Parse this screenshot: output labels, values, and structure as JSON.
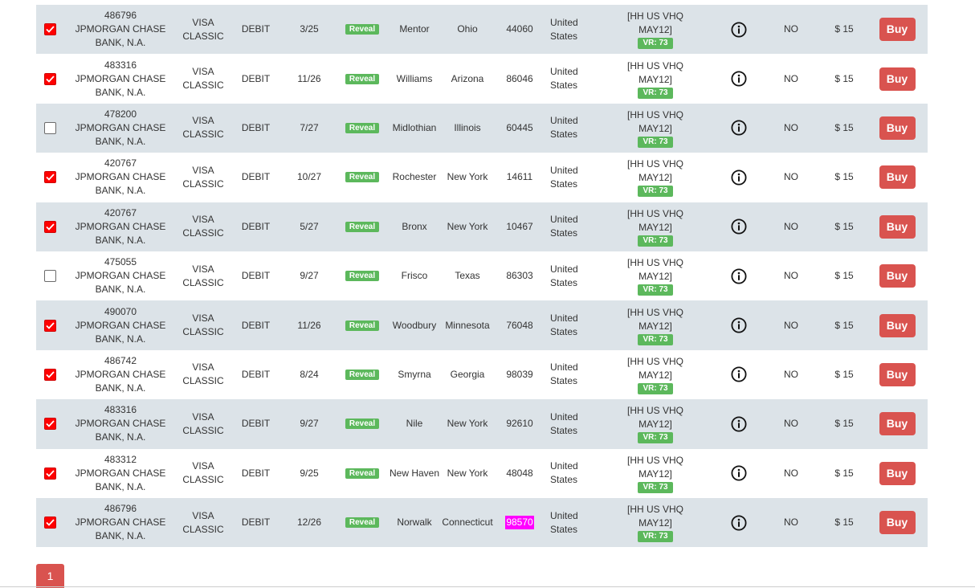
{
  "colors": {
    "row_shaded": "#dce3e8",
    "checkbox_checked": "#ff0000",
    "reveal_badge": "#5cb85c",
    "buy_button": "#d9534f",
    "zip_highlight": "#ff00ff"
  },
  "rows": [
    {
      "checked": true,
      "bin": "486796",
      "bank": "JPMORGAN CHASE",
      "bank2": "BANK, N.A.",
      "brand": "VISA",
      "level": "CLASSIC",
      "type": "DEBIT",
      "exp": "3/25",
      "reveal": "Reveal",
      "city": "Mentor",
      "state": "Ohio",
      "zip": "44060",
      "country": "United",
      "country2": "States",
      "base1": "[HH US VHQ",
      "base2": "MAY12]",
      "vr": "VR: 73",
      "info_icon": "info-circle-icon",
      "refund": "NO",
      "price": "$ 15",
      "buy": "Buy"
    },
    {
      "checked": true,
      "bin": "483316",
      "bank": "JPMORGAN CHASE",
      "bank2": "BANK, N.A.",
      "brand": "VISA",
      "level": "CLASSIC",
      "type": "DEBIT",
      "exp": "11/26",
      "reveal": "Reveal",
      "city": "Williams",
      "state": "Arizona",
      "zip": "86046",
      "country": "United",
      "country2": "States",
      "base1": "[HH US VHQ",
      "base2": "MAY12]",
      "vr": "VR: 73",
      "info_icon": "info-circle-icon",
      "refund": "NO",
      "price": "$ 15",
      "buy": "Buy"
    },
    {
      "checked": false,
      "bin": "478200",
      "bank": "JPMORGAN CHASE",
      "bank2": "BANK, N.A.",
      "brand": "VISA",
      "level": "CLASSIC",
      "type": "DEBIT",
      "exp": "7/27",
      "reveal": "Reveal",
      "city": "Midlothian",
      "state": "Illinois",
      "zip": "60445",
      "country": "United",
      "country2": "States",
      "base1": "[HH US VHQ",
      "base2": "MAY12]",
      "vr": "VR: 73",
      "info_icon": "info-circle-icon",
      "refund": "NO",
      "price": "$ 15",
      "buy": "Buy"
    },
    {
      "checked": true,
      "bin": "420767",
      "bank": "JPMORGAN CHASE",
      "bank2": "BANK, N.A.",
      "brand": "VISA",
      "level": "CLASSIC",
      "type": "DEBIT",
      "exp": "10/27",
      "reveal": "Reveal",
      "city": "Rochester",
      "state": "New York",
      "zip": "14611",
      "country": "United",
      "country2": "States",
      "base1": "[HH US VHQ",
      "base2": "MAY12]",
      "vr": "VR: 73",
      "info_icon": "info-circle-icon",
      "refund": "NO",
      "price": "$ 15",
      "buy": "Buy"
    },
    {
      "checked": true,
      "bin": "420767",
      "bank": "JPMORGAN CHASE",
      "bank2": "BANK, N.A.",
      "brand": "VISA",
      "level": "CLASSIC",
      "type": "DEBIT",
      "exp": "5/27",
      "reveal": "Reveal",
      "city": "Bronx",
      "state": "New York",
      "zip": "10467",
      "country": "United",
      "country2": "States",
      "base1": "[HH US VHQ",
      "base2": "MAY12]",
      "vr": "VR: 73",
      "info_icon": "info-circle-icon",
      "refund": "NO",
      "price": "$ 15",
      "buy": "Buy"
    },
    {
      "checked": false,
      "bin": "475055",
      "bank": "JPMORGAN CHASE",
      "bank2": "BANK, N.A.",
      "brand": "VISA",
      "level": "CLASSIC",
      "type": "DEBIT",
      "exp": "9/27",
      "reveal": "Reveal",
      "city": "Frisco",
      "state": "Texas",
      "zip": "86303",
      "country": "United",
      "country2": "States",
      "base1": "[HH US VHQ",
      "base2": "MAY12]",
      "vr": "VR: 73",
      "info_icon": "info-circle-icon",
      "refund": "NO",
      "price": "$ 15",
      "buy": "Buy"
    },
    {
      "checked": true,
      "bin": "490070",
      "bank": "JPMORGAN CHASE",
      "bank2": "BANK, N.A.",
      "brand": "VISA",
      "level": "CLASSIC",
      "type": "DEBIT",
      "exp": "11/26",
      "reveal": "Reveal",
      "city": "Woodbury",
      "state": "Minnesota",
      "zip": "76048",
      "country": "United",
      "country2": "States",
      "base1": "[HH US VHQ",
      "base2": "MAY12]",
      "vr": "VR: 73",
      "info_icon": "info-circle-icon",
      "refund": "NO",
      "price": "$ 15",
      "buy": "Buy"
    },
    {
      "checked": true,
      "bin": "486742",
      "bank": "JPMORGAN CHASE",
      "bank2": "BANK, N.A.",
      "brand": "VISA",
      "level": "CLASSIC",
      "type": "DEBIT",
      "exp": "8/24",
      "reveal": "Reveal",
      "city": "Smyrna",
      "state": "Georgia",
      "zip": "98039",
      "country": "United",
      "country2": "States",
      "base1": "[HH US VHQ",
      "base2": "MAY12]",
      "vr": "VR: 73",
      "info_icon": "info-circle-icon",
      "refund": "NO",
      "price": "$ 15",
      "buy": "Buy"
    },
    {
      "checked": true,
      "bin": "483316",
      "bank": "JPMORGAN CHASE",
      "bank2": "BANK, N.A.",
      "brand": "VISA",
      "level": "CLASSIC",
      "type": "DEBIT",
      "exp": "9/27",
      "reveal": "Reveal",
      "city": "Nile",
      "state": "New York",
      "zip": "92610",
      "country": "United",
      "country2": "States",
      "base1": "[HH US VHQ",
      "base2": "MAY12]",
      "vr": "VR: 73",
      "info_icon": "info-circle-icon",
      "refund": "NO",
      "price": "$ 15",
      "buy": "Buy"
    },
    {
      "checked": true,
      "bin": "483312",
      "bank": "JPMORGAN CHASE",
      "bank2": "BANK, N.A.",
      "brand": "VISA",
      "level": "CLASSIC",
      "type": "DEBIT",
      "exp": "9/25",
      "reveal": "Reveal",
      "city": "New Haven",
      "state": "New York",
      "zip": "48048",
      "country": "United",
      "country2": "States",
      "base1": "[HH US VHQ",
      "base2": "MAY12]",
      "vr": "VR: 73",
      "info_icon": "info-circle-icon",
      "refund": "NO",
      "price": "$ 15",
      "buy": "Buy"
    },
    {
      "checked": true,
      "bin": "486796",
      "bank": "JPMORGAN CHASE",
      "bank2": "BANK, N.A.",
      "brand": "VISA",
      "level": "CLASSIC",
      "type": "DEBIT",
      "exp": "12/26",
      "reveal": "Reveal",
      "city": "Norwalk",
      "state": "Connecticut",
      "zip": "98570",
      "zip_highlighted": true,
      "country": "United",
      "country2": "States",
      "base1": "[HH US VHQ",
      "base2": "MAY12]",
      "vr": "VR: 73",
      "info_icon": "info-circle-icon",
      "refund": "NO",
      "price": "$ 15",
      "buy": "Buy"
    }
  ],
  "pagination": {
    "current_page": "1"
  }
}
